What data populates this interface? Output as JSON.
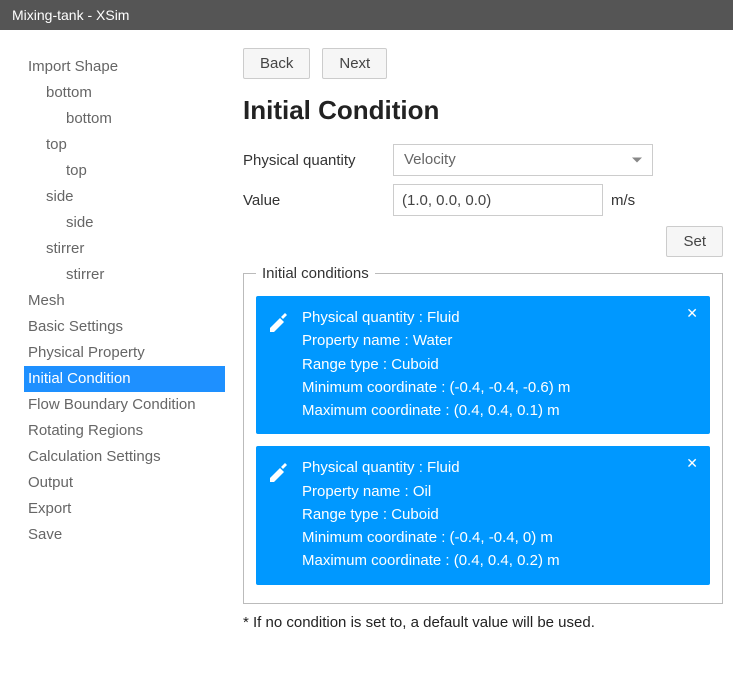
{
  "window_title": "Mixing-tank - XSim",
  "sidebar": {
    "items": [
      {
        "label": "Import Shape",
        "indent": 0
      },
      {
        "label": "bottom",
        "indent": 1
      },
      {
        "label": "bottom",
        "indent": 2
      },
      {
        "label": "top",
        "indent": 1
      },
      {
        "label": "top",
        "indent": 2
      },
      {
        "label": "side",
        "indent": 1
      },
      {
        "label": "side",
        "indent": 2
      },
      {
        "label": "stirrer",
        "indent": 1
      },
      {
        "label": "stirrer",
        "indent": 2
      },
      {
        "label": "Mesh",
        "indent": 0
      },
      {
        "label": "Basic Settings",
        "indent": 0
      },
      {
        "label": "Physical Property",
        "indent": 0
      },
      {
        "label": "Initial Condition",
        "indent": 0,
        "selected": true
      },
      {
        "label": "Flow Boundary Condition",
        "indent": 0
      },
      {
        "label": "Rotating Regions",
        "indent": 0
      },
      {
        "label": "Calculation Settings",
        "indent": 0
      },
      {
        "label": "Output",
        "indent": 0
      },
      {
        "label": "Export",
        "indent": 0
      },
      {
        "label": "Save",
        "indent": 0
      }
    ]
  },
  "nav": {
    "back": "Back",
    "next": "Next"
  },
  "page": {
    "title": "Initial Condition",
    "physical_quantity_label": "Physical quantity",
    "physical_quantity_value": "Velocity",
    "value_label": "Value",
    "value_value": "(1.0, 0.0, 0.0)",
    "value_unit": "m/s",
    "set_label": "Set",
    "fieldset_legend": "Initial conditions",
    "footnote": "* If no condition is set to, a default value will be used."
  },
  "conditions": [
    {
      "lines": [
        "Physical quantity : Fluid",
        "Property name : Water",
        "Range type : Cuboid",
        "Minimum coordinate : (-0.4, -0.4, -0.6) m",
        "Maximum coordinate : (0.4, 0.4, 0.1) m"
      ]
    },
    {
      "lines": [
        "Physical quantity : Fluid",
        "Property name : Oil",
        "Range type : Cuboid",
        "Minimum coordinate : (-0.4, -0.4, 0) m",
        "Maximum coordinate : (0.4, 0.4, 0.2) m"
      ]
    }
  ]
}
